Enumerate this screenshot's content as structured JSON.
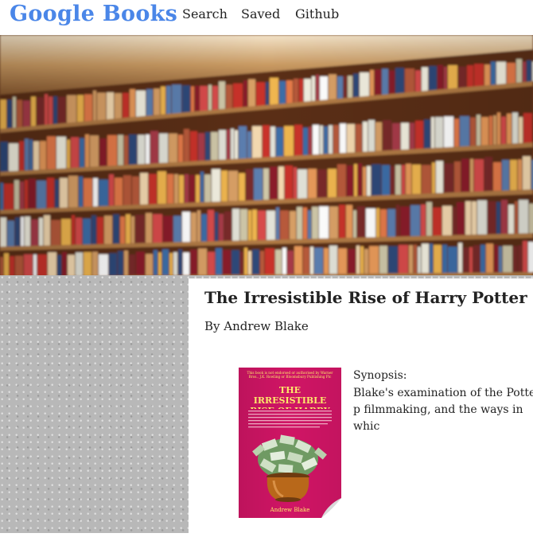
{
  "navbar": {
    "brand": "Google Books",
    "links": [
      "Search",
      "Saved",
      "Github"
    ]
  },
  "book": {
    "title": "The Irresistible Rise of Harry Potter",
    "author": "By Andrew Blake",
    "synopsis_label": "Synopsis:",
    "synopsis_text": "Blake's examination of the Potter p filmmaking, and the ways in whic",
    "cover": {
      "header_text": "This book is not endorsed or authorised by Warner Bros., J.K. Rowling or Bloomsbury Publishing Plc",
      "title": "THE IRRESISTIBLE RISE OF HARRY POTTER",
      "author": "Andrew Blake"
    }
  },
  "colors": {
    "brand": "#4a86e8",
    "cover_bg": "#d01565",
    "cover_text": "#fde96a",
    "page_bg": "#b8b8b8"
  }
}
